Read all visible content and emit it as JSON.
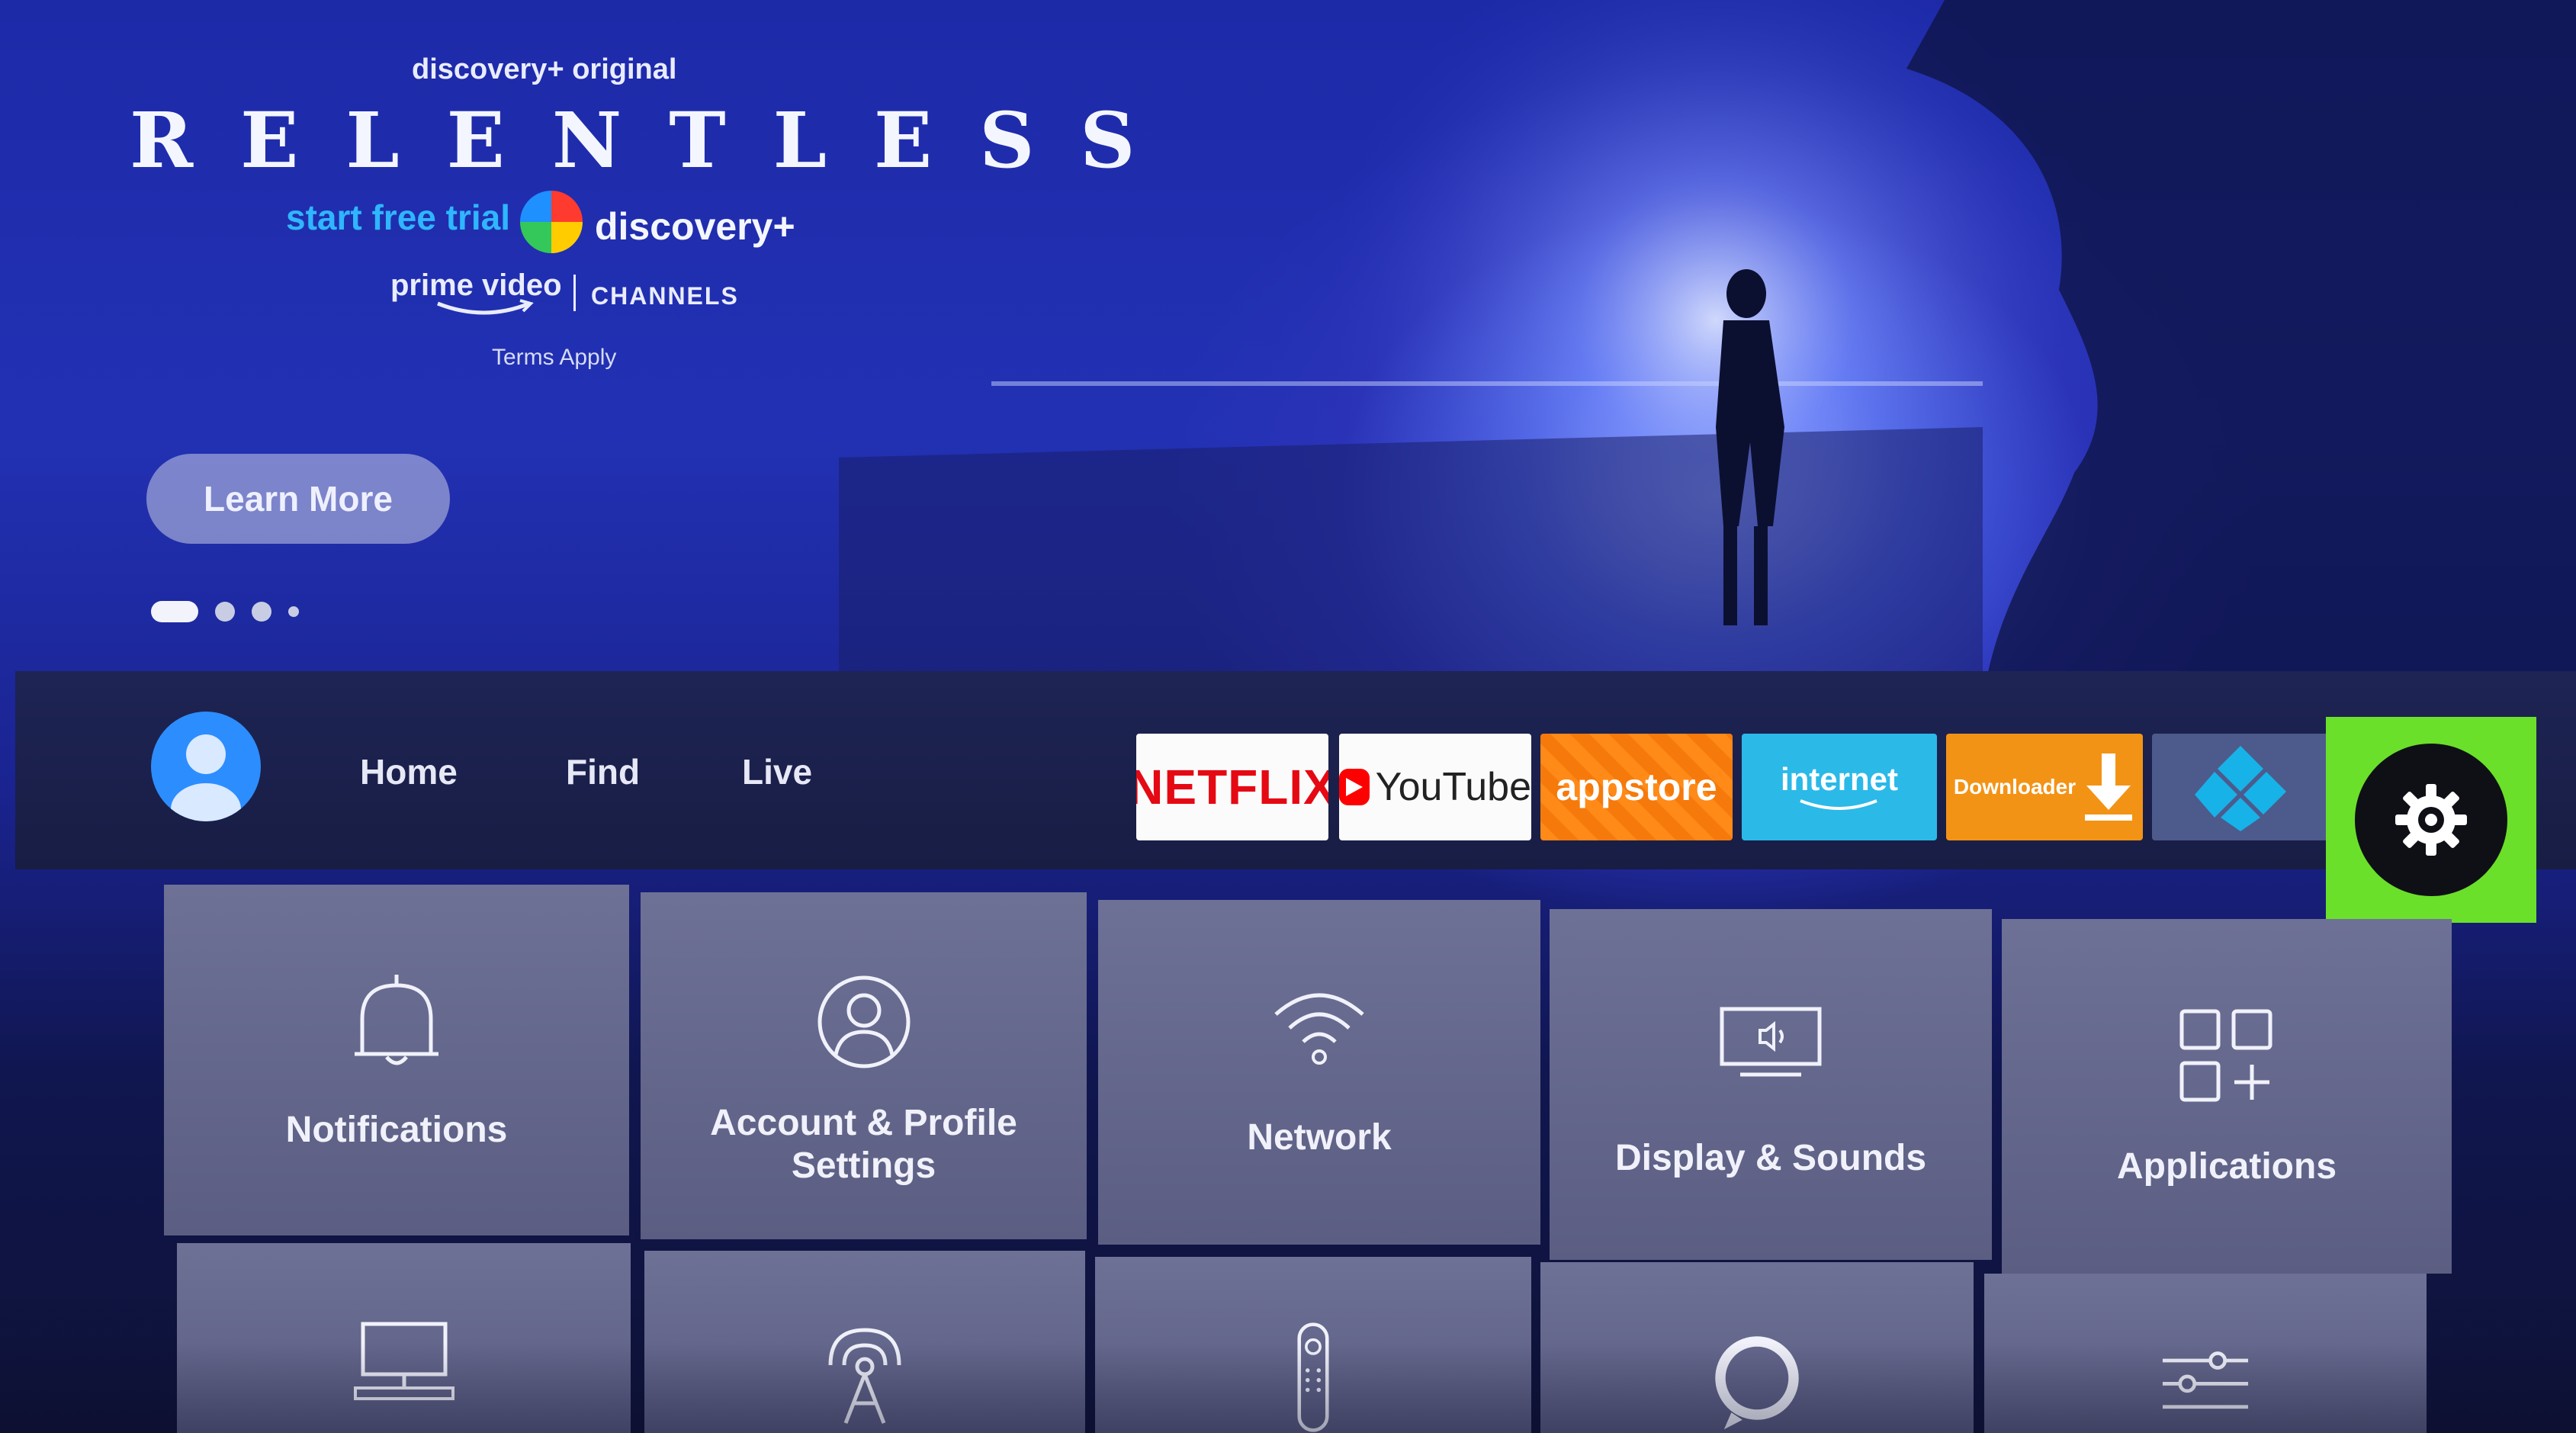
{
  "hero": {
    "network_tag": "discovery+ original",
    "show_title": "RELENTLESS",
    "trial_text": "start free trial",
    "brand_name": "discovery+",
    "prime_label": "prime video",
    "channels_label": "CHANNELS",
    "terms": "Terms Apply",
    "learn_more": "Learn More",
    "carousel_count": 4,
    "carousel_active_index": 0
  },
  "nav": {
    "home": "Home",
    "find": "Find",
    "live": "Live"
  },
  "apps": {
    "netflix": "NETFLIX",
    "youtube": "YouTube",
    "appstore": "appstore",
    "internet": "internet",
    "downloader": "Downloader",
    "kodi_icon": "kodi-logo-icon",
    "settings_icon": "gear-icon"
  },
  "settings_tiles": {
    "row1": [
      {
        "label": "Notifications",
        "icon": "bell-icon"
      },
      {
        "label": "Account & Profile Settings",
        "icon": "user-icon"
      },
      {
        "label": "Network",
        "icon": "wifi-icon"
      },
      {
        "label": "Display & Sounds",
        "icon": "display-sound-icon"
      },
      {
        "label": "Applications",
        "icon": "apps-grid-icon"
      }
    ],
    "row2_icons": [
      "computer-icon",
      "antenna-icon",
      "remote-icon",
      "alexa-ring-icon",
      "sliders-icon"
    ]
  },
  "colors": {
    "focus_highlight": "#6be02a",
    "netflix_red": "#e50914",
    "appstore_orange": "#ff8a17",
    "internet_blue": "#2bb9e8",
    "downloader_orange": "#f39315"
  }
}
